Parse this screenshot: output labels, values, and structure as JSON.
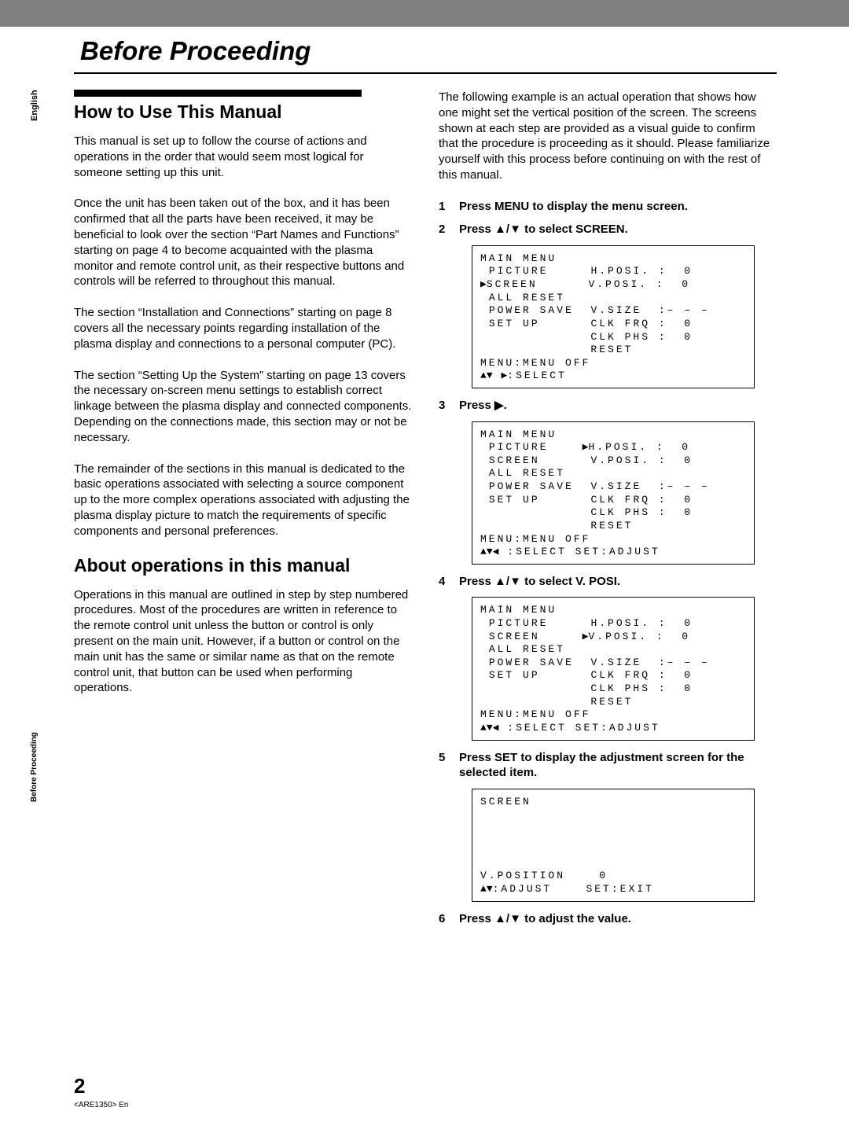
{
  "meta": {
    "lang_label": "English",
    "section_label": "Before Proceeding",
    "page_number": "2",
    "doc_id": "<ARE1350> En"
  },
  "chapter": {
    "title": "Before Proceeding"
  },
  "left": {
    "h1": "How to Use This Manual",
    "p1": "This manual is set up to follow the course of actions and operations in the order that would seem most logical for someone setting up this unit.",
    "p2": "Once the unit has been taken out of the box, and it has been confirmed that all the parts have been received, it may be beneficial to look over the section “Part Names and Functions” starting on page 4 to become acquainted with the plasma monitor and remote control unit, as their respective buttons and controls will be referred to throughout this manual.",
    "p3": "The section “Installation and Connections” starting on page 8 covers all the necessary points regarding installation of the plasma display and connections to a personal computer (PC).",
    "p4": "The section “Setting Up the System” starting on page 13 covers the necessary on-screen menu settings to establish correct linkage between the plasma display and connected components. Depending on the connections made, this section may or not be necessary.",
    "p5": "The remainder of the sections in this manual is dedicated to the basic operations associated with selecting a source component up to the more complex operations associated with adjusting the plasma display picture to match the requirements of specific components and personal preferences.",
    "h2": "About operations in this manual",
    "p6": "Operations in this manual are outlined in step by step numbered procedures. Most of the procedures are written in reference to the remote control unit unless the button or control is only present on the main unit. However, if a button or control on the main unit has the same or similar name as that on the remote control unit, that button can be used when performing operations."
  },
  "right": {
    "intro": "The following example is an actual operation that shows how one might set the vertical position of the screen. The screens shown at each step are provided as a visual guide to confirm that the procedure is proceeding as it should.  Please familiarize yourself with this process before continuing on with the rest of this manual.",
    "steps": {
      "s1": "Press MENU to display the menu screen.",
      "s2_pre": "Press ",
      "s2_mid": "/",
      "s2_post": " to select SCREEN.",
      "s3_pre": "Press ",
      "s3_post": ".",
      "s4_pre": "Press ",
      "s4_mid": "/",
      "s4_post": " to select V. POSI.",
      "s5": "Press SET to display the adjustment screen for the selected item.",
      "s6_pre": "Press ",
      "s6_mid": "/",
      "s6_post": " to adjust the value."
    },
    "osd_common": {
      "title": "MAIN MENU",
      "picture": "PICTURE",
      "screen": "SCREEN",
      "all_reset": "ALL RESET",
      "power_save": "POWER SAVE",
      "set_up": "SET UP",
      "hposi": "H.POSI.",
      "vposi": "V.POSI.",
      "vsize": "V.SIZE",
      "clkfrq": "CLK FRQ",
      "clkphs": "CLK PHS",
      "reset": "RESET",
      "menu_off": "MENU:MENU OFF",
      "select": ":SELECT",
      "select_set_adjust": ":SELECT SET:ADJUST",
      "v0": "0",
      "dashes": "– – –"
    },
    "osd_adjust": {
      "title": "SCREEN",
      "param": "V.POSITION",
      "value": "0",
      "adjust": ":ADJUST",
      "exit": "SET:EXIT"
    }
  }
}
